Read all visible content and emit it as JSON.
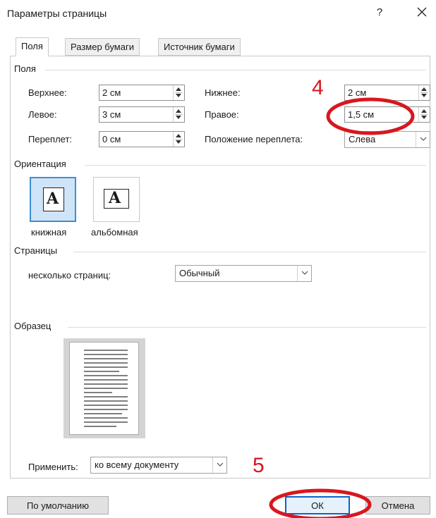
{
  "window": {
    "title": "Параметры страницы",
    "help_label": "?",
    "close_label": "✕"
  },
  "tabs": [
    {
      "label": "Поля",
      "active": true
    },
    {
      "label": "Размер бумаги",
      "active": false
    },
    {
      "label": "Источник бумаги",
      "active": false
    }
  ],
  "margins": {
    "group_label": "Поля",
    "top_label": "Верхнее:",
    "top_value": "2 см",
    "bottom_label": "Нижнее:",
    "bottom_value": "2 см",
    "left_label": "Левое:",
    "left_value": "3 см",
    "right_label": "Правое:",
    "right_value": "1,5 см",
    "gutter_label": "Переплет:",
    "gutter_value": "0 см",
    "gutter_pos_label": "Положение переплета:",
    "gutter_pos_value": "Слева"
  },
  "orientation": {
    "group_label": "Ориентация",
    "portrait_label": "книжная",
    "landscape_label": "альбомная",
    "glyph": "A",
    "selected": "portrait"
  },
  "pages": {
    "group_label": "Страницы",
    "multiple_label": "несколько страниц:",
    "multiple_value": "Обычный"
  },
  "preview": {
    "group_label": "Образец"
  },
  "apply": {
    "label": "Применить:",
    "value": "ко всему документу"
  },
  "buttons": {
    "default_label": "По умолчанию",
    "ok_label": "ОК",
    "cancel_label": "Отмена"
  },
  "annotations": {
    "step4": "4",
    "step5": "5",
    "color": "#d8171f"
  },
  "colors": {
    "accent": "#0a64c8",
    "selected_fill": "#cfe4f7"
  }
}
